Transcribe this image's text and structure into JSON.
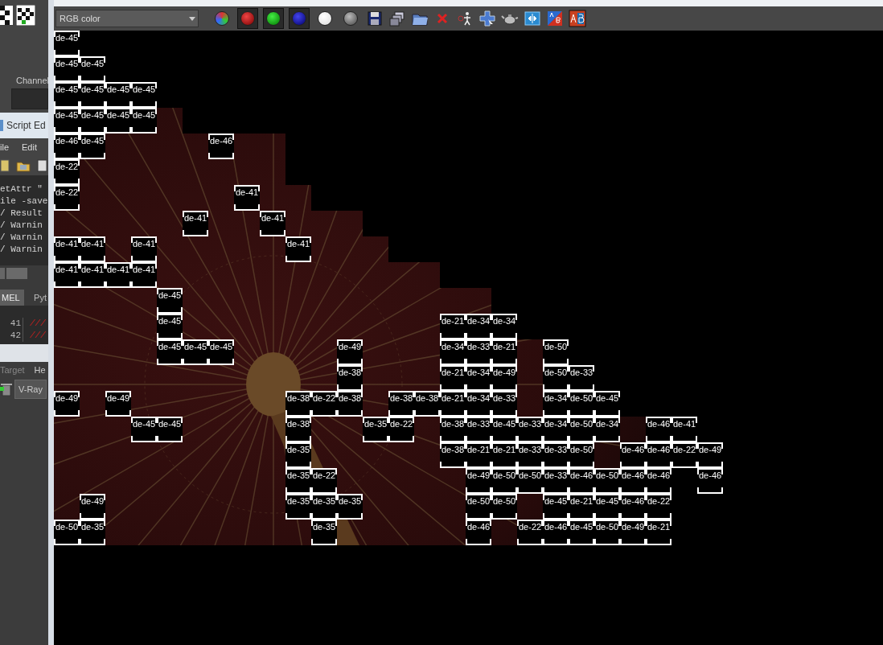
{
  "left_panel": {
    "channel_label": "Channel",
    "script_editor": {
      "title": "Script Ed",
      "menu": [
        "ile",
        "Edit"
      ],
      "output_lines": [
        "etAttr \"",
        "ile -save",
        "/ Result",
        "/ Warnin",
        "/ Warnin",
        "/ Warnin"
      ],
      "tabs": [
        {
          "label": "MEL",
          "selected": true
        },
        {
          "label": "Pyt",
          "selected": false
        }
      ],
      "lines": [
        {
          "number": "41",
          "text": "///"
        },
        {
          "number": "42",
          "text": "///"
        }
      ]
    },
    "shelf": {
      "labels": [
        "Target",
        "He"
      ],
      "button": "V-Ray"
    }
  },
  "toolbar": {
    "channel_select": {
      "value": "RGB color"
    },
    "channel_toggles": [
      {
        "kind": "rgb",
        "on": false
      },
      {
        "kind": "red",
        "on": true
      },
      {
        "kind": "green",
        "on": true
      },
      {
        "kind": "blue",
        "on": true
      },
      {
        "kind": "alpha",
        "on": false
      },
      {
        "kind": "mono",
        "on": false
      }
    ]
  },
  "render_grid": {
    "rows": [
      {
        "cells": [
          {
            "kind": "bucket",
            "label": "de-45"
          }
        ]
      },
      {
        "cells": [
          {
            "kind": "bucket",
            "label": "de-45"
          },
          {
            "kind": "bucket",
            "label": "de-45"
          }
        ]
      },
      {
        "cells": [
          {
            "kind": "bucket",
            "label": "de-45"
          },
          {
            "kind": "bucket",
            "label": "de-45"
          },
          {
            "kind": "bucket",
            "label": "de-45"
          },
          {
            "kind": "bucket",
            "label": "de-45"
          }
        ]
      },
      {
        "cells": [
          {
            "kind": "bucket",
            "label": "de-45"
          },
          {
            "kind": "bucket",
            "label": "de-45"
          },
          {
            "kind": "bucket",
            "label": "de-45"
          },
          {
            "kind": "bucket",
            "label": "de-45"
          },
          {
            "kind": "image"
          }
        ]
      },
      {
        "cells": [
          {
            "kind": "bucket",
            "label": "de-46"
          },
          {
            "kind": "bucket",
            "label": "de-45"
          },
          {
            "kind": "image"
          },
          {
            "kind": "image"
          },
          {
            "kind": "image"
          },
          {
            "kind": "image"
          },
          {
            "kind": "bucket",
            "label": "de-46"
          },
          {
            "kind": "image"
          },
          {
            "kind": "image"
          }
        ]
      },
      {
        "cells": [
          {
            "kind": "bucket",
            "label": "de-22"
          },
          {
            "kind": "image"
          },
          {
            "kind": "image"
          },
          {
            "kind": "image"
          },
          {
            "kind": "image"
          },
          {
            "kind": "image"
          },
          {
            "kind": "image"
          },
          {
            "kind": "image"
          },
          {
            "kind": "image"
          }
        ]
      },
      {
        "cells": [
          {
            "kind": "bucket",
            "label": "de-22"
          },
          {
            "kind": "image"
          },
          {
            "kind": "image"
          },
          {
            "kind": "image"
          },
          {
            "kind": "image"
          },
          {
            "kind": "image"
          },
          {
            "kind": "image"
          },
          {
            "kind": "bucket",
            "label": "de-41"
          },
          {
            "kind": "image"
          },
          {
            "kind": "image"
          }
        ]
      },
      {
        "cells": [
          {
            "kind": "image"
          },
          {
            "kind": "image"
          },
          {
            "kind": "image"
          },
          {
            "kind": "image"
          },
          {
            "kind": "image"
          },
          {
            "kind": "bucket",
            "label": "de-41"
          },
          {
            "kind": "image"
          },
          {
            "kind": "image"
          },
          {
            "kind": "bucket",
            "label": "de-41"
          },
          {
            "kind": "image"
          },
          {
            "kind": "image"
          },
          {
            "kind": "image"
          }
        ]
      },
      {
        "cells": [
          {
            "kind": "bucket",
            "label": "de-41"
          },
          {
            "kind": "bucket",
            "label": "de-41"
          },
          {
            "kind": "image"
          },
          {
            "kind": "bucket",
            "label": "de-41"
          },
          {
            "kind": "image"
          },
          {
            "kind": "image"
          },
          {
            "kind": "image"
          },
          {
            "kind": "image"
          },
          {
            "kind": "image"
          },
          {
            "kind": "bucket",
            "label": "de-41"
          },
          {
            "kind": "image"
          },
          {
            "kind": "image"
          },
          {
            "kind": "image"
          }
        ]
      },
      {
        "cells": [
          {
            "kind": "bucket",
            "label": "de-41"
          },
          {
            "kind": "bucket",
            "label": "de-41"
          },
          {
            "kind": "bucket",
            "label": "de-41"
          },
          {
            "kind": "bucket",
            "label": "de-41"
          },
          {
            "kind": "image"
          },
          {
            "kind": "image"
          },
          {
            "kind": "image"
          },
          {
            "kind": "image"
          },
          {
            "kind": "image"
          },
          {
            "kind": "image"
          },
          {
            "kind": "image"
          },
          {
            "kind": "image"
          },
          {
            "kind": "image"
          },
          {
            "kind": "image"
          },
          {
            "kind": "image"
          }
        ]
      },
      {
        "cells": [
          {
            "kind": "image"
          },
          {
            "kind": "image"
          },
          {
            "kind": "image"
          },
          {
            "kind": "image"
          },
          {
            "kind": "bucket",
            "label": "de-45"
          },
          {
            "kind": "image"
          },
          {
            "kind": "image"
          },
          {
            "kind": "image"
          },
          {
            "kind": "image"
          },
          {
            "kind": "image"
          },
          {
            "kind": "image"
          },
          {
            "kind": "image"
          },
          {
            "kind": "image"
          },
          {
            "kind": "image"
          },
          {
            "kind": "image"
          },
          {
            "kind": "image"
          },
          {
            "kind": "image"
          }
        ]
      },
      {
        "cells": [
          {
            "kind": "image"
          },
          {
            "kind": "image"
          },
          {
            "kind": "image"
          },
          {
            "kind": "image"
          },
          {
            "kind": "bucket",
            "label": "de-45"
          },
          {
            "kind": "image"
          },
          {
            "kind": "image"
          },
          {
            "kind": "image"
          },
          {
            "kind": "image"
          },
          {
            "kind": "image"
          },
          {
            "kind": "image"
          },
          {
            "kind": "image"
          },
          {
            "kind": "image"
          },
          {
            "kind": "image"
          },
          {
            "kind": "image"
          },
          {
            "kind": "bucket",
            "label": "de-21"
          },
          {
            "kind": "bucket",
            "label": "de-34"
          },
          {
            "kind": "bucket",
            "label": "de-34"
          }
        ]
      },
      {
        "cells": [
          {
            "kind": "image"
          },
          {
            "kind": "image"
          },
          {
            "kind": "image"
          },
          {
            "kind": "image"
          },
          {
            "kind": "bucket",
            "label": "de-45"
          },
          {
            "kind": "bucket",
            "label": "de-45"
          },
          {
            "kind": "bucket",
            "label": "de-45"
          },
          {
            "kind": "image"
          },
          {
            "kind": "image"
          },
          {
            "kind": "image"
          },
          {
            "kind": "image"
          },
          {
            "kind": "bucket",
            "label": "de-49"
          },
          {
            "kind": "image"
          },
          {
            "kind": "image"
          },
          {
            "kind": "image"
          },
          {
            "kind": "bucket",
            "label": "de-34"
          },
          {
            "kind": "bucket",
            "label": "de-33"
          },
          {
            "kind": "bucket",
            "label": "de-21"
          },
          {
            "kind": "image"
          },
          {
            "kind": "bucket",
            "label": "de-50"
          }
        ]
      },
      {
        "cells": [
          {
            "kind": "image"
          },
          {
            "kind": "image"
          },
          {
            "kind": "image"
          },
          {
            "kind": "image"
          },
          {
            "kind": "image"
          },
          {
            "kind": "image"
          },
          {
            "kind": "image"
          },
          {
            "kind": "image"
          },
          {
            "kind": "image"
          },
          {
            "kind": "image"
          },
          {
            "kind": "image"
          },
          {
            "kind": "bucket",
            "label": "de-38"
          },
          {
            "kind": "image"
          },
          {
            "kind": "image"
          },
          {
            "kind": "image"
          },
          {
            "kind": "bucket",
            "label": "de-21"
          },
          {
            "kind": "bucket",
            "label": "de-34"
          },
          {
            "kind": "bucket",
            "label": "de-49"
          },
          {
            "kind": "image"
          },
          {
            "kind": "bucket",
            "label": "de-50"
          },
          {
            "kind": "bucket",
            "label": "de-33"
          }
        ]
      },
      {
        "cells": [
          {
            "kind": "bucket",
            "label": "de-49"
          },
          {
            "kind": "image"
          },
          {
            "kind": "bucket",
            "label": "de-49"
          },
          {
            "kind": "image"
          },
          {
            "kind": "image"
          },
          {
            "kind": "image"
          },
          {
            "kind": "image"
          },
          {
            "kind": "image"
          },
          {
            "kind": "image"
          },
          {
            "kind": "bucket",
            "label": "de-38"
          },
          {
            "kind": "bucket",
            "label": "de-22"
          },
          {
            "kind": "bucket",
            "label": "de-38"
          },
          {
            "kind": "image"
          },
          {
            "kind": "bucket",
            "label": "de-38"
          },
          {
            "kind": "bucket",
            "label": "de-38"
          },
          {
            "kind": "bucket",
            "label": "de-21"
          },
          {
            "kind": "bucket",
            "label": "de-34"
          },
          {
            "kind": "bucket",
            "label": "de-33"
          },
          {
            "kind": "image"
          },
          {
            "kind": "bucket",
            "label": "de-34"
          },
          {
            "kind": "bucket",
            "label": "de-50"
          },
          {
            "kind": "bucket",
            "label": "de-45"
          }
        ]
      },
      {
        "cells": [
          {
            "kind": "image"
          },
          {
            "kind": "image"
          },
          {
            "kind": "image"
          },
          {
            "kind": "bucket",
            "label": "de-45"
          },
          {
            "kind": "bucket",
            "label": "de-45"
          },
          {
            "kind": "image"
          },
          {
            "kind": "image"
          },
          {
            "kind": "image"
          },
          {
            "kind": "image"
          },
          {
            "kind": "bucket",
            "label": "de-38"
          },
          {
            "kind": "image"
          },
          {
            "kind": "image"
          },
          {
            "kind": "bucket",
            "label": "de-35"
          },
          {
            "kind": "bucket",
            "label": "de-22"
          },
          {
            "kind": "image"
          },
          {
            "kind": "bucket",
            "label": "de-38"
          },
          {
            "kind": "bucket",
            "label": "de-33"
          },
          {
            "kind": "bucket",
            "label": "de-45"
          },
          {
            "kind": "bucket",
            "label": "de-33"
          },
          {
            "kind": "bucket",
            "label": "de-34"
          },
          {
            "kind": "bucket",
            "label": "de-50"
          },
          {
            "kind": "bucket",
            "label": "de-34"
          },
          {
            "kind": "image"
          },
          {
            "kind": "bucket",
            "label": "de-46"
          },
          {
            "kind": "bucket",
            "label": "de-41"
          }
        ]
      },
      {
        "cells": [
          {
            "kind": "image"
          },
          {
            "kind": "image"
          },
          {
            "kind": "image"
          },
          {
            "kind": "image"
          },
          {
            "kind": "image"
          },
          {
            "kind": "image"
          },
          {
            "kind": "image"
          },
          {
            "kind": "image"
          },
          {
            "kind": "image"
          },
          {
            "kind": "bucket",
            "label": "de-35"
          },
          {
            "kind": "image"
          },
          {
            "kind": "image"
          },
          {
            "kind": "image"
          },
          {
            "kind": "image"
          },
          {
            "kind": "image"
          },
          {
            "kind": "bucket",
            "label": "de-38"
          },
          {
            "kind": "bucket",
            "label": "de-21"
          },
          {
            "kind": "bucket",
            "label": "de-21"
          },
          {
            "kind": "bucket",
            "label": "de-33"
          },
          {
            "kind": "bucket",
            "label": "de-33"
          },
          {
            "kind": "bucket",
            "label": "de-50"
          },
          {
            "kind": "image"
          },
          {
            "kind": "bucket",
            "label": "de-46"
          },
          {
            "kind": "bucket",
            "label": "de-46"
          },
          {
            "kind": "bucket",
            "label": "de-22"
          },
          {
            "kind": "bucket",
            "label": "de-49"
          }
        ]
      },
      {
        "cells": [
          {
            "kind": "image"
          },
          {
            "kind": "image"
          },
          {
            "kind": "image"
          },
          {
            "kind": "image"
          },
          {
            "kind": "image"
          },
          {
            "kind": "image"
          },
          {
            "kind": "image"
          },
          {
            "kind": "image"
          },
          {
            "kind": "image"
          },
          {
            "kind": "bucket",
            "label": "de-35"
          },
          {
            "kind": "bucket",
            "label": "de-22"
          },
          {
            "kind": "image"
          },
          {
            "kind": "image"
          },
          {
            "kind": "image"
          },
          {
            "kind": "image"
          },
          {
            "kind": "image"
          },
          {
            "kind": "bucket",
            "label": "de-49"
          },
          {
            "kind": "bucket",
            "label": "de-50"
          },
          {
            "kind": "bucket",
            "label": "de-50"
          },
          {
            "kind": "bucket",
            "label": "de-33"
          },
          {
            "kind": "bucket",
            "label": "de-46"
          },
          {
            "kind": "bucket",
            "label": "de-50"
          },
          {
            "kind": "bucket",
            "label": "de-46"
          },
          {
            "kind": "bucket",
            "label": "de-46"
          },
          {
            "kind": "blank"
          },
          {
            "kind": "bucket",
            "label": "de-46"
          }
        ]
      },
      {
        "cells": [
          {
            "kind": "image"
          },
          {
            "kind": "bucket",
            "label": "de-49"
          },
          {
            "kind": "image"
          },
          {
            "kind": "image"
          },
          {
            "kind": "image"
          },
          {
            "kind": "image"
          },
          {
            "kind": "image"
          },
          {
            "kind": "image"
          },
          {
            "kind": "image"
          },
          {
            "kind": "bucket",
            "label": "de-35"
          },
          {
            "kind": "bucket",
            "label": "de-35"
          },
          {
            "kind": "bucket",
            "label": "de-35"
          },
          {
            "kind": "image"
          },
          {
            "kind": "image"
          },
          {
            "kind": "image"
          },
          {
            "kind": "image"
          },
          {
            "kind": "bucket",
            "label": "de-50"
          },
          {
            "kind": "bucket",
            "label": "de-50"
          },
          {
            "kind": "image"
          },
          {
            "kind": "bucket",
            "label": "de-45"
          },
          {
            "kind": "bucket",
            "label": "de-21"
          },
          {
            "kind": "bucket",
            "label": "de-45"
          },
          {
            "kind": "bucket",
            "label": "de-46"
          },
          {
            "kind": "bucket",
            "label": "de-22"
          }
        ]
      },
      {
        "cells": [
          {
            "kind": "bucket",
            "label": "de-50"
          },
          {
            "kind": "bucket",
            "label": "de-35"
          },
          {
            "kind": "image"
          },
          {
            "kind": "image"
          },
          {
            "kind": "image"
          },
          {
            "kind": "image"
          },
          {
            "kind": "image"
          },
          {
            "kind": "image"
          },
          {
            "kind": "image"
          },
          {
            "kind": "image"
          },
          {
            "kind": "bucket",
            "label": "de-35"
          },
          {
            "kind": "image"
          },
          {
            "kind": "image"
          },
          {
            "kind": "image"
          },
          {
            "kind": "image"
          },
          {
            "kind": "image"
          },
          {
            "kind": "bucket",
            "label": "de-46"
          },
          {
            "kind": "image"
          },
          {
            "kind": "bucket",
            "label": "de-22"
          },
          {
            "kind": "bucket",
            "label": "de-46"
          },
          {
            "kind": "bucket",
            "label": "de-45"
          },
          {
            "kind": "bucket",
            "label": "de-50"
          },
          {
            "kind": "bucket",
            "label": "de-49"
          },
          {
            "kind": "bucket",
            "label": "de-21"
          }
        ]
      }
    ]
  }
}
